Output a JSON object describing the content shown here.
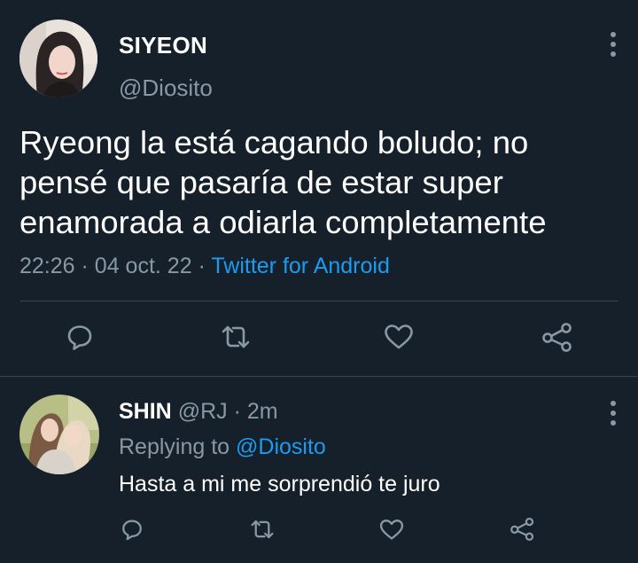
{
  "main_tweet": {
    "author_name": "SIYEON",
    "author_handle": "@Diosito",
    "text": "Ryeong la está cagando boludo; no\npensé que pasaría de estar super\nenamorada a odiarla completamente",
    "time": "22:26",
    "date": "04 oct. 22",
    "separator": "·",
    "client": "Twitter for Android",
    "actions": [
      "reply-icon",
      "retweet-icon",
      "like-icon",
      "share-icon"
    ]
  },
  "reply_tweet": {
    "author_name": "SHIN",
    "author_handle": "@RJ",
    "separator": "·",
    "age": "2m",
    "replying_prefix": "Replying to",
    "replying_to": "@Diosito",
    "text": "Hasta a mi me sorprendió te juro",
    "actions": [
      "reply-icon",
      "retweet-icon",
      "like-icon",
      "share-icon"
    ]
  },
  "colors": {
    "background": "#15202b",
    "text_primary": "#ffffff",
    "text_secondary": "#8899a6",
    "accent": "#1d9bf0",
    "divider": "#38444d"
  }
}
